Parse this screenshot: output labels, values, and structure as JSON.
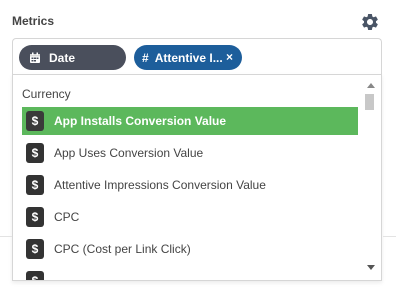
{
  "header": {
    "title": "Metrics",
    "settings_icon": "gear-icon"
  },
  "chips": [
    {
      "label": "Date",
      "icon": "calendar-icon",
      "color": "#4a4f5c"
    },
    {
      "label": "Attentive I...",
      "icon": "hash-icon",
      "close": "×",
      "color": "#1d5e9b"
    }
  ],
  "dropdown": {
    "group_label": "Currency",
    "options": [
      {
        "label": "App Installs Conversion Value",
        "icon": "$",
        "selected": true
      },
      {
        "label": "App Uses Conversion Value",
        "icon": "$",
        "selected": false
      },
      {
        "label": "Attentive Impressions Conversion Value",
        "icon": "$",
        "selected": false
      },
      {
        "label": "CPC",
        "icon": "$",
        "selected": false
      },
      {
        "label": "CPC (Cost per Link Click)",
        "icon": "$",
        "selected": false
      },
      {
        "label": "",
        "icon": "$",
        "selected": false
      }
    ],
    "highlight_color": "#5cb85c"
  }
}
